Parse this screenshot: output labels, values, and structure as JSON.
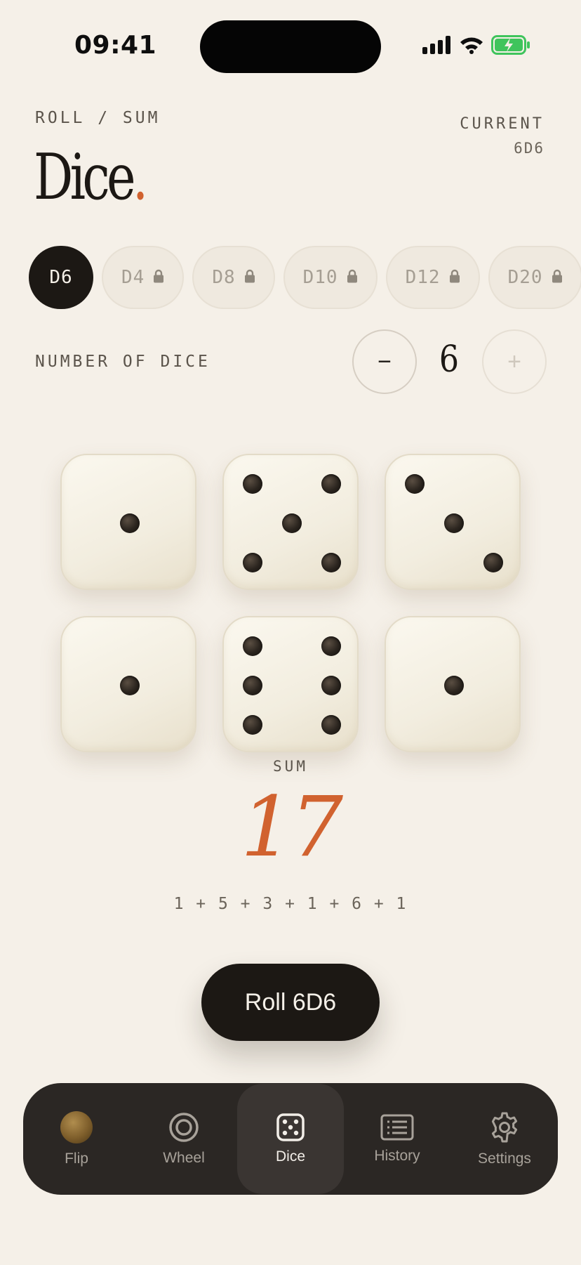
{
  "status": {
    "time": "09:41"
  },
  "header": {
    "eyebrow": "ROLL / SUM",
    "title": "Dice",
    "title_dot": ".",
    "current_label": "CURRENT",
    "current_value": "6D6"
  },
  "dice_types": [
    {
      "label": "D6",
      "active": true,
      "locked": false
    },
    {
      "label": "D4",
      "active": false,
      "locked": true
    },
    {
      "label": "D8",
      "active": false,
      "locked": true
    },
    {
      "label": "D10",
      "active": false,
      "locked": true
    },
    {
      "label": "D12",
      "active": false,
      "locked": true
    },
    {
      "label": "D20",
      "active": false,
      "locked": true
    }
  ],
  "number_of_dice": {
    "label": "NUMBER OF DICE",
    "minus": "−",
    "plus": "+",
    "value": "6"
  },
  "dice_faces": [
    1,
    5,
    3,
    1,
    6,
    1
  ],
  "sum": {
    "label": "SUM",
    "value": "17",
    "breakdown": "1 + 5 + 3 + 1 + 6 + 1"
  },
  "roll_button": {
    "label": "Roll 6D6"
  },
  "tabs": [
    {
      "label": "Flip",
      "icon": "coin-icon",
      "active": false
    },
    {
      "label": "Wheel",
      "icon": "wheel-icon",
      "active": false
    },
    {
      "label": "Dice",
      "icon": "dice-icon",
      "active": true
    },
    {
      "label": "History",
      "icon": "history-icon",
      "active": false
    },
    {
      "label": "Settings",
      "icon": "gear-icon",
      "active": false
    }
  ],
  "colors": {
    "background": "#F5F0E8",
    "accent": "#D1622F",
    "ink": "#1C1814",
    "tabbar": "#2B2724",
    "battery": "#3FC45C"
  }
}
